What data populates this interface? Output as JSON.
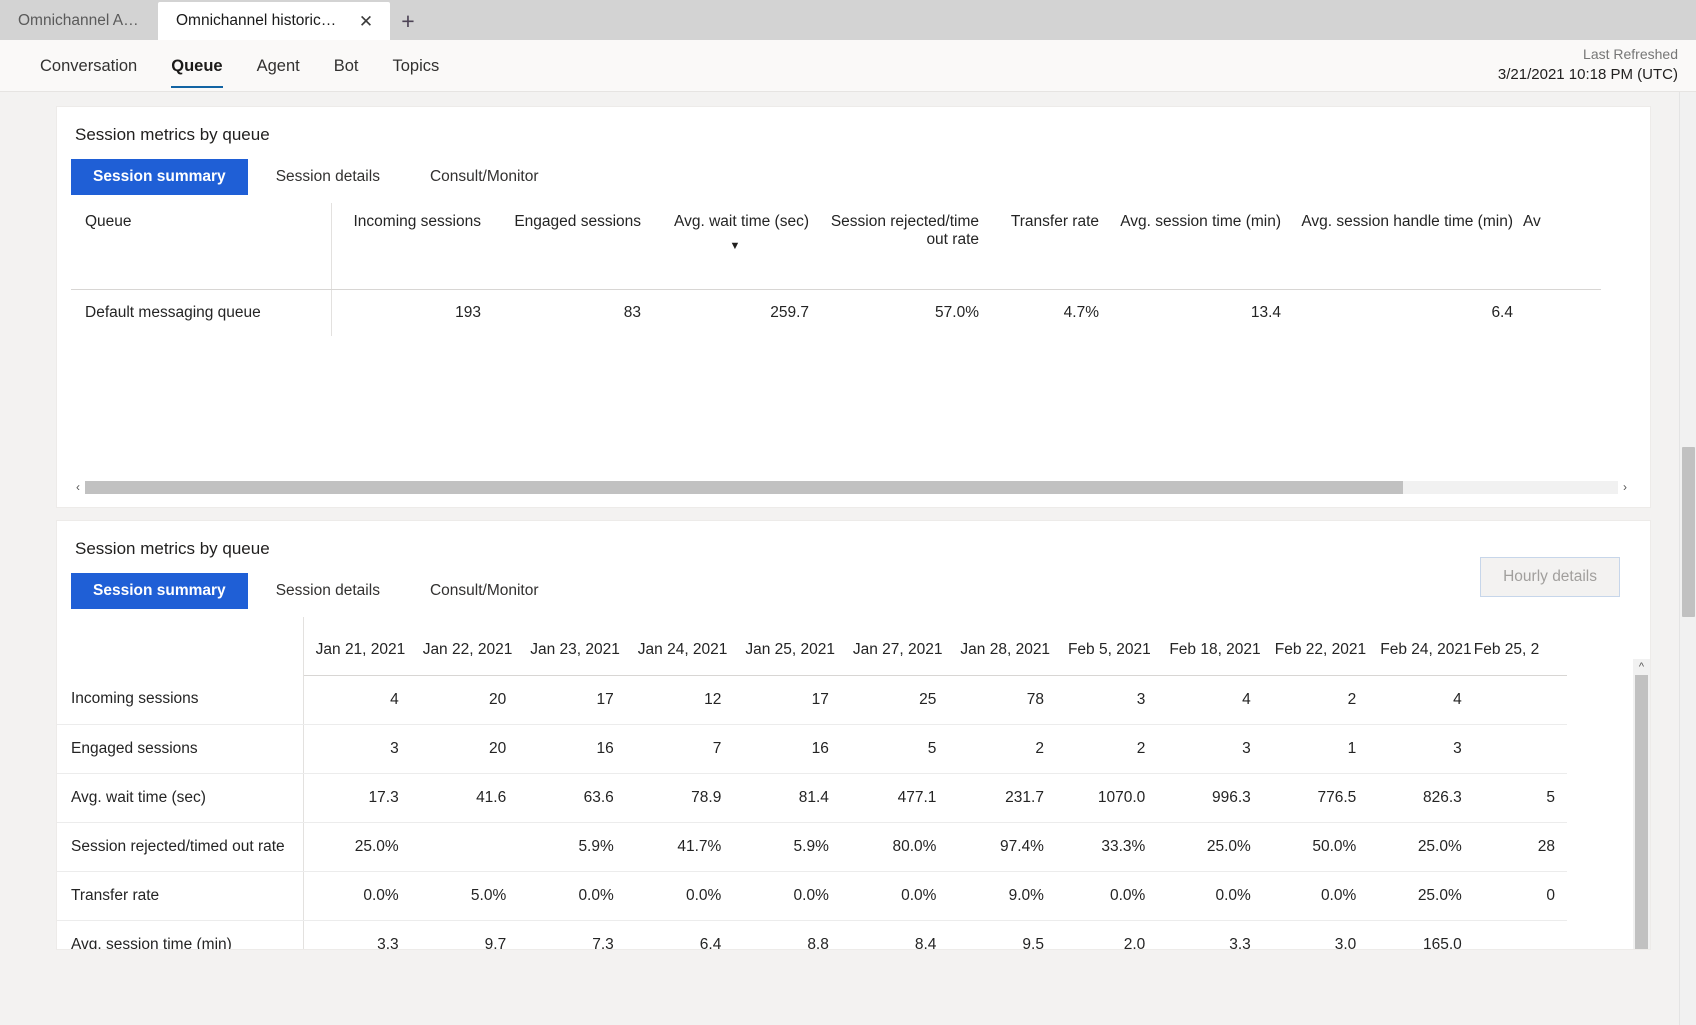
{
  "browser": {
    "tabs": [
      {
        "title": "Omnichannel Age...",
        "active": false
      },
      {
        "title": "Omnichannel historical an...",
        "active": true
      }
    ],
    "close_icon": "close-icon",
    "new_tab_icon": "plus-icon"
  },
  "header": {
    "nav_tabs": [
      {
        "label": "Conversation",
        "selected": false
      },
      {
        "label": "Queue",
        "selected": true
      },
      {
        "label": "Agent",
        "selected": false
      },
      {
        "label": "Bot",
        "selected": false
      },
      {
        "label": "Topics",
        "selected": false
      }
    ],
    "refresh_label": "Last Refreshed",
    "refresh_value": "3/21/2021 10:18 PM (UTC)",
    "accent_color": "#1264a3"
  },
  "panel1": {
    "title": "Session metrics by queue",
    "pivots": [
      {
        "label": "Session summary",
        "active": true
      },
      {
        "label": "Session details",
        "active": false
      },
      {
        "label": "Consult/Monitor",
        "active": false
      }
    ],
    "columns": [
      "Queue",
      "Incoming sessions",
      "Engaged sessions",
      "Avg. wait time (sec)",
      "Session rejected/time out rate",
      "Transfer rate",
      "Avg. session time (min)",
      "Avg. session handle time (min)",
      "Av"
    ],
    "sorted_column_index": 3,
    "sort_arrow": "▼",
    "rows": [
      {
        "queue": "Default messaging queue",
        "values": [
          "193",
          "83",
          "259.7",
          "57.0%",
          "4.7%",
          "13.4",
          "6.4",
          ""
        ]
      }
    ],
    "scroll_left_icon": "chevron-left-icon",
    "scroll_right_icon": "chevron-right-icon",
    "accent_color": "#1f5fd6"
  },
  "panel2": {
    "title": "Session metrics by queue",
    "pivots": [
      {
        "label": "Session summary",
        "active": true
      },
      {
        "label": "Session details",
        "active": false
      },
      {
        "label": "Consult/Monitor",
        "active": false
      }
    ],
    "hourly_details_label": "Hourly details",
    "scroll_up_icon": "chevron-up-icon",
    "chart_data": {
      "type": "table",
      "title": "Session metrics by queue",
      "categories": [
        "Jan 21, 2021",
        "Jan 22, 2021",
        "Jan 23, 2021",
        "Jan 24, 2021",
        "Jan 25, 2021",
        "Jan 27, 2021",
        "Jan 28, 2021",
        "Feb 5, 2021",
        "Feb 18, 2021",
        "Feb 22, 2021",
        "Feb 24, 2021",
        "Feb 25, 2"
      ],
      "series": [
        {
          "name": "Incoming sessions",
          "values": [
            "4",
            "20",
            "17",
            "12",
            "17",
            "25",
            "78",
            "3",
            "4",
            "2",
            "4",
            ""
          ]
        },
        {
          "name": "Engaged sessions",
          "values": [
            "3",
            "20",
            "16",
            "7",
            "16",
            "5",
            "2",
            "2",
            "3",
            "1",
            "3",
            ""
          ]
        },
        {
          "name": "Avg. wait time (sec)",
          "values": [
            "17.3",
            "41.6",
            "63.6",
            "78.9",
            "81.4",
            "477.1",
            "231.7",
            "1070.0",
            "996.3",
            "776.5",
            "826.3",
            "5"
          ]
        },
        {
          "name": "Session rejected/timed out rate",
          "values": [
            "25.0%",
            "",
            "5.9%",
            "41.7%",
            "5.9%",
            "80.0%",
            "97.4%",
            "33.3%",
            "25.0%",
            "50.0%",
            "25.0%",
            "28"
          ]
        },
        {
          "name": "Transfer rate",
          "values": [
            "0.0%",
            "5.0%",
            "0.0%",
            "0.0%",
            "0.0%",
            "0.0%",
            "9.0%",
            "0.0%",
            "0.0%",
            "0.0%",
            "25.0%",
            "0"
          ]
        },
        {
          "name": "Avg. session time (min)",
          "values": [
            "3.3",
            "9.7",
            "7.3",
            "6.4",
            "8.8",
            "8.4",
            "9.5",
            "2.0",
            "3.3",
            "3.0",
            "165.0",
            ""
          ]
        }
      ]
    }
  }
}
